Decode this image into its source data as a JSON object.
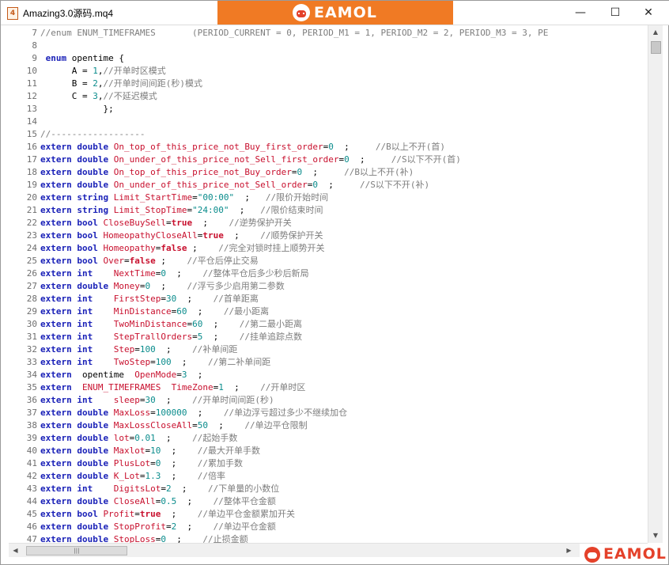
{
  "window": {
    "title": "Amazing3.0源码.mq4",
    "app_icon_glyph": "4",
    "minimize_glyph": "—",
    "maximize_glyph": "☐",
    "close_glyph": "✕"
  },
  "brand": {
    "banner_text": "EAMOL",
    "banner_color": "#f07a24",
    "footer_text": "EAMOL",
    "footer_color": "#e4412a"
  },
  "scrollbar": {
    "up_glyph": "▲",
    "down_glyph": "▼",
    "left_glyph": "◀",
    "right_glyph": "▶",
    "thumb_grip": "|||"
  },
  "code_lines": [
    {
      "n": "7",
      "t": [
        [
          "cm",
          "//enum ENUM_TIMEFRAMES       (PERIOD_CURRENT = 0, PERIOD_M1 = 1, PERIOD_M2 = 2, PERIOD_M3 = 3, PE"
        ]
      ]
    },
    {
      "n": "8",
      "t": []
    },
    {
      "n": "9",
      "t": [
        [
          "op",
          " "
        ],
        [
          "kw",
          "enum"
        ],
        [
          "op",
          " opentime {"
        ]
      ]
    },
    {
      "n": "10",
      "t": [
        [
          "op",
          "      A = "
        ],
        [
          "num",
          "1"
        ],
        [
          "op",
          ","
        ],
        [
          "cm",
          "//开单时区模式"
        ]
      ]
    },
    {
      "n": "11",
      "t": [
        [
          "op",
          "      B = "
        ],
        [
          "num",
          "2"
        ],
        [
          "op",
          ","
        ],
        [
          "cm",
          "//开单时间间距(秒)模式"
        ]
      ]
    },
    {
      "n": "12",
      "t": [
        [
          "op",
          "      C = "
        ],
        [
          "num",
          "3"
        ],
        [
          "op",
          ","
        ],
        [
          "cm",
          "//不延迟模式"
        ]
      ]
    },
    {
      "n": "13",
      "t": [
        [
          "op",
          "            };"
        ]
      ]
    },
    {
      "n": "14",
      "t": []
    },
    {
      "n": "15",
      "t": [
        [
          "cm",
          "//------------------"
        ]
      ]
    },
    {
      "n": "16",
      "t": [
        [
          "kw",
          "extern"
        ],
        [
          "op",
          " "
        ],
        [
          "ty",
          "double"
        ],
        [
          "op",
          " "
        ],
        [
          "var",
          "On_top_of_this_price_not_Buy_first_order"
        ],
        [
          "op",
          "="
        ],
        [
          "num",
          "0"
        ],
        [
          "op",
          "  ;     "
        ],
        [
          "cm",
          "//B以上不开(首)"
        ]
      ]
    },
    {
      "n": "17",
      "t": [
        [
          "kw",
          "extern"
        ],
        [
          "op",
          " "
        ],
        [
          "ty",
          "double"
        ],
        [
          "op",
          " "
        ],
        [
          "var",
          "On_under_of_this_price_not_Sell_first_order"
        ],
        [
          "op",
          "="
        ],
        [
          "num",
          "0"
        ],
        [
          "op",
          "  ;     "
        ],
        [
          "cm",
          "//S以下不开(首)"
        ]
      ]
    },
    {
      "n": "18",
      "t": [
        [
          "kw",
          "extern"
        ],
        [
          "op",
          " "
        ],
        [
          "ty",
          "double"
        ],
        [
          "op",
          " "
        ],
        [
          "var",
          "On_top_of_this_price_not_Buy_order"
        ],
        [
          "op",
          "="
        ],
        [
          "num",
          "0"
        ],
        [
          "op",
          "  ;     "
        ],
        [
          "cm",
          "//B以上不开(补)"
        ]
      ]
    },
    {
      "n": "19",
      "t": [
        [
          "kw",
          "extern"
        ],
        [
          "op",
          " "
        ],
        [
          "ty",
          "double"
        ],
        [
          "op",
          " "
        ],
        [
          "var",
          "On_under_of_this_price_not_Sell_order"
        ],
        [
          "op",
          "="
        ],
        [
          "num",
          "0"
        ],
        [
          "op",
          "  ;     "
        ],
        [
          "cm",
          "//S以下不开(补)"
        ]
      ]
    },
    {
      "n": "20",
      "t": [
        [
          "kw",
          "extern"
        ],
        [
          "op",
          " "
        ],
        [
          "ty",
          "string"
        ],
        [
          "op",
          " "
        ],
        [
          "var",
          "Limit_StartTime"
        ],
        [
          "op",
          "="
        ],
        [
          "str",
          "\"00:00\""
        ],
        [
          "op",
          "  ;   "
        ],
        [
          "cm",
          "//限价开始时间"
        ]
      ]
    },
    {
      "n": "21",
      "t": [
        [
          "kw",
          "extern"
        ],
        [
          "op",
          " "
        ],
        [
          "ty",
          "string"
        ],
        [
          "op",
          " "
        ],
        [
          "var",
          "Limit_StopTime"
        ],
        [
          "op",
          "="
        ],
        [
          "str",
          "\"24:00\""
        ],
        [
          "op",
          "  ;   "
        ],
        [
          "cm",
          "//限价结束时间"
        ]
      ]
    },
    {
      "n": "22",
      "t": [
        [
          "kw",
          "extern"
        ],
        [
          "op",
          " "
        ],
        [
          "ty",
          "bool"
        ],
        [
          "op",
          " "
        ],
        [
          "var",
          "CloseBuySell"
        ],
        [
          "op",
          "="
        ],
        [
          "bool",
          "true"
        ],
        [
          "op",
          "  ;    "
        ],
        [
          "cm",
          "//逆势保护开关"
        ]
      ]
    },
    {
      "n": "23",
      "t": [
        [
          "kw",
          "extern"
        ],
        [
          "op",
          " "
        ],
        [
          "ty",
          "bool"
        ],
        [
          "op",
          " "
        ],
        [
          "var",
          "HomeopathyCloseAll"
        ],
        [
          "op",
          "="
        ],
        [
          "bool",
          "true"
        ],
        [
          "op",
          "  ;    "
        ],
        [
          "cm",
          "//顺势保护开关"
        ]
      ]
    },
    {
      "n": "24",
      "t": [
        [
          "kw",
          "extern"
        ],
        [
          "op",
          " "
        ],
        [
          "ty",
          "bool"
        ],
        [
          "op",
          " "
        ],
        [
          "var",
          "Homeopathy"
        ],
        [
          "op",
          "="
        ],
        [
          "bool",
          "false"
        ],
        [
          "op",
          " ;    "
        ],
        [
          "cm",
          "//完全对锁时挂上顺势开关"
        ]
      ]
    },
    {
      "n": "25",
      "t": [
        [
          "kw",
          "extern"
        ],
        [
          "op",
          " "
        ],
        [
          "ty",
          "bool"
        ],
        [
          "op",
          " "
        ],
        [
          "var",
          "Over"
        ],
        [
          "op",
          "="
        ],
        [
          "bool",
          "false"
        ],
        [
          "op",
          " ;    "
        ],
        [
          "cm",
          "//平仓后停止交易"
        ]
      ]
    },
    {
      "n": "26",
      "t": [
        [
          "kw",
          "extern"
        ],
        [
          "op",
          " "
        ],
        [
          "ty",
          "int"
        ],
        [
          "op",
          "    "
        ],
        [
          "var",
          "NextTime"
        ],
        [
          "op",
          "="
        ],
        [
          "num",
          "0"
        ],
        [
          "op",
          "  ;    "
        ],
        [
          "cm",
          "//整体平仓后多少秒后新局"
        ]
      ]
    },
    {
      "n": "27",
      "t": [
        [
          "kw",
          "extern"
        ],
        [
          "op",
          " "
        ],
        [
          "ty",
          "double"
        ],
        [
          "op",
          " "
        ],
        [
          "var",
          "Money"
        ],
        [
          "op",
          "="
        ],
        [
          "num",
          "0"
        ],
        [
          "op",
          "  ;    "
        ],
        [
          "cm",
          "//浮亏多少启用第二参数"
        ]
      ]
    },
    {
      "n": "28",
      "t": [
        [
          "kw",
          "extern"
        ],
        [
          "op",
          " "
        ],
        [
          "ty",
          "int"
        ],
        [
          "op",
          "    "
        ],
        [
          "var",
          "FirstStep"
        ],
        [
          "op",
          "="
        ],
        [
          "num",
          "30"
        ],
        [
          "op",
          "  ;    "
        ],
        [
          "cm",
          "//首单距离"
        ]
      ]
    },
    {
      "n": "29",
      "t": [
        [
          "kw",
          "extern"
        ],
        [
          "op",
          " "
        ],
        [
          "ty",
          "int"
        ],
        [
          "op",
          "    "
        ],
        [
          "var",
          "MinDistance"
        ],
        [
          "op",
          "="
        ],
        [
          "num",
          "60"
        ],
        [
          "op",
          "  ;    "
        ],
        [
          "cm",
          "//最小距离"
        ]
      ]
    },
    {
      "n": "30",
      "t": [
        [
          "kw",
          "extern"
        ],
        [
          "op",
          " "
        ],
        [
          "ty",
          "int"
        ],
        [
          "op",
          "    "
        ],
        [
          "var",
          "TwoMinDistance"
        ],
        [
          "op",
          "="
        ],
        [
          "num",
          "60"
        ],
        [
          "op",
          "  ;    "
        ],
        [
          "cm",
          "//第二最小距离"
        ]
      ]
    },
    {
      "n": "31",
      "t": [
        [
          "kw",
          "extern"
        ],
        [
          "op",
          " "
        ],
        [
          "ty",
          "int"
        ],
        [
          "op",
          "    "
        ],
        [
          "var",
          "StepTrallOrders"
        ],
        [
          "op",
          "="
        ],
        [
          "num",
          "5"
        ],
        [
          "op",
          "  ;    "
        ],
        [
          "cm",
          "//挂单追踪点数"
        ]
      ]
    },
    {
      "n": "32",
      "t": [
        [
          "kw",
          "extern"
        ],
        [
          "op",
          " "
        ],
        [
          "ty",
          "int"
        ],
        [
          "op",
          "    "
        ],
        [
          "var",
          "Step"
        ],
        [
          "op",
          "="
        ],
        [
          "num",
          "100"
        ],
        [
          "op",
          "  ;    "
        ],
        [
          "cm",
          "//补单间距"
        ]
      ]
    },
    {
      "n": "33",
      "t": [
        [
          "kw",
          "extern"
        ],
        [
          "op",
          " "
        ],
        [
          "ty",
          "int"
        ],
        [
          "op",
          "    "
        ],
        [
          "var",
          "TwoStep"
        ],
        [
          "op",
          "="
        ],
        [
          "num",
          "100"
        ],
        [
          "op",
          "  ;    "
        ],
        [
          "cm",
          "//第二补单间距"
        ]
      ]
    },
    {
      "n": "34",
      "t": [
        [
          "kw",
          "extern"
        ],
        [
          "op",
          "  opentime  "
        ],
        [
          "var",
          "OpenMode"
        ],
        [
          "op",
          "="
        ],
        [
          "num",
          "3"
        ],
        [
          "op",
          "  ;"
        ]
      ]
    },
    {
      "n": "35",
      "t": [
        [
          "kw",
          "extern"
        ],
        [
          "op",
          "  "
        ],
        [
          "var",
          "ENUM_TIMEFRAMES"
        ],
        [
          "op",
          "  "
        ],
        [
          "var",
          "TimeZone"
        ],
        [
          "op",
          "="
        ],
        [
          "num",
          "1"
        ],
        [
          "op",
          "  ;    "
        ],
        [
          "cm",
          "//开单时区"
        ]
      ]
    },
    {
      "n": "36",
      "t": [
        [
          "kw",
          "extern"
        ],
        [
          "op",
          " "
        ],
        [
          "ty",
          "int"
        ],
        [
          "op",
          "    "
        ],
        [
          "var",
          "sleep"
        ],
        [
          "op",
          "="
        ],
        [
          "num",
          "30"
        ],
        [
          "op",
          "  ;    "
        ],
        [
          "cm",
          "//开单时间间距(秒)"
        ]
      ]
    },
    {
      "n": "37",
      "t": [
        [
          "kw",
          "extern"
        ],
        [
          "op",
          " "
        ],
        [
          "ty",
          "double"
        ],
        [
          "op",
          " "
        ],
        [
          "var",
          "MaxLoss"
        ],
        [
          "op",
          "="
        ],
        [
          "num",
          "100000"
        ],
        [
          "op",
          "  ;    "
        ],
        [
          "cm",
          "//单边浮亏超过多少不继续加仓"
        ]
      ]
    },
    {
      "n": "38",
      "t": [
        [
          "kw",
          "extern"
        ],
        [
          "op",
          " "
        ],
        [
          "ty",
          "double"
        ],
        [
          "op",
          " "
        ],
        [
          "var",
          "MaxLossCloseAll"
        ],
        [
          "op",
          "="
        ],
        [
          "num",
          "50"
        ],
        [
          "op",
          "  ;    "
        ],
        [
          "cm",
          "//单边平仓限制"
        ]
      ]
    },
    {
      "n": "39",
      "t": [
        [
          "kw",
          "extern"
        ],
        [
          "op",
          " "
        ],
        [
          "ty",
          "double"
        ],
        [
          "op",
          " "
        ],
        [
          "var",
          "lot"
        ],
        [
          "op",
          "="
        ],
        [
          "num",
          "0.01"
        ],
        [
          "op",
          "  ;    "
        ],
        [
          "cm",
          "//起始手数"
        ]
      ]
    },
    {
      "n": "40",
      "t": [
        [
          "kw",
          "extern"
        ],
        [
          "op",
          " "
        ],
        [
          "ty",
          "double"
        ],
        [
          "op",
          " "
        ],
        [
          "var",
          "Maxlot"
        ],
        [
          "op",
          "="
        ],
        [
          "num",
          "10"
        ],
        [
          "op",
          "  ;    "
        ],
        [
          "cm",
          "//最大开单手数"
        ]
      ]
    },
    {
      "n": "41",
      "t": [
        [
          "kw",
          "extern"
        ],
        [
          "op",
          " "
        ],
        [
          "ty",
          "double"
        ],
        [
          "op",
          " "
        ],
        [
          "var",
          "PlusLot"
        ],
        [
          "op",
          "="
        ],
        [
          "num",
          "0"
        ],
        [
          "op",
          "  ;    "
        ],
        [
          "cm",
          "//累加手数"
        ]
      ]
    },
    {
      "n": "42",
      "t": [
        [
          "kw",
          "extern"
        ],
        [
          "op",
          " "
        ],
        [
          "ty",
          "double"
        ],
        [
          "op",
          " "
        ],
        [
          "var",
          "K_Lot"
        ],
        [
          "op",
          "="
        ],
        [
          "num",
          "1.3"
        ],
        [
          "op",
          "  ;    "
        ],
        [
          "cm",
          "//倍率"
        ]
      ]
    },
    {
      "n": "43",
      "t": [
        [
          "kw",
          "extern"
        ],
        [
          "op",
          " "
        ],
        [
          "ty",
          "int"
        ],
        [
          "op",
          "    "
        ],
        [
          "var",
          "DigitsLot"
        ],
        [
          "op",
          "="
        ],
        [
          "num",
          "2"
        ],
        [
          "op",
          "  ;    "
        ],
        [
          "cm",
          "//下单量的小数位"
        ]
      ]
    },
    {
      "n": "44",
      "t": [
        [
          "kw",
          "extern"
        ],
        [
          "op",
          " "
        ],
        [
          "ty",
          "double"
        ],
        [
          "op",
          " "
        ],
        [
          "var",
          "CloseAll"
        ],
        [
          "op",
          "="
        ],
        [
          "num",
          "0.5"
        ],
        [
          "op",
          "  ;    "
        ],
        [
          "cm",
          "//整体平仓金额"
        ]
      ]
    },
    {
      "n": "45",
      "t": [
        [
          "kw",
          "extern"
        ],
        [
          "op",
          " "
        ],
        [
          "ty",
          "bool"
        ],
        [
          "op",
          " "
        ],
        [
          "var",
          "Profit"
        ],
        [
          "op",
          "="
        ],
        [
          "bool",
          "true"
        ],
        [
          "op",
          "  ;    "
        ],
        [
          "cm",
          "//单边平仓金额累加开关"
        ]
      ]
    },
    {
      "n": "46",
      "t": [
        [
          "kw",
          "extern"
        ],
        [
          "op",
          " "
        ],
        [
          "ty",
          "double"
        ],
        [
          "op",
          " "
        ],
        [
          "var",
          "StopProfit"
        ],
        [
          "op",
          "="
        ],
        [
          "num",
          "2"
        ],
        [
          "op",
          "  ;    "
        ],
        [
          "cm",
          "//单边平仓金额"
        ]
      ]
    },
    {
      "n": "47",
      "t": [
        [
          "kw",
          "extern"
        ],
        [
          "op",
          " "
        ],
        [
          "ty",
          "double"
        ],
        [
          "op",
          " "
        ],
        [
          "var",
          "StopLoss"
        ],
        [
          "op",
          "="
        ],
        [
          "num",
          "0"
        ],
        [
          "op",
          "  ;    "
        ],
        [
          "cm",
          "//止损金额"
        ]
      ]
    }
  ]
}
